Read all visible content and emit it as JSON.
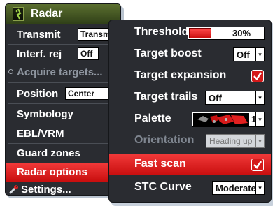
{
  "menu": {
    "title": "Radar",
    "items": [
      {
        "label": "Transmit",
        "value": "Transm"
      },
      {
        "label": "Interf. rej",
        "value": "Off"
      },
      {
        "label": "Acquire targets..."
      },
      {
        "label": "Position",
        "value": "Center"
      },
      {
        "label": "Symbology"
      },
      {
        "label": "EBL/VRM"
      },
      {
        "label": "Guard zones"
      },
      {
        "label": "Radar options"
      },
      {
        "label": "Settings..."
      }
    ]
  },
  "options": {
    "threshold": {
      "label": "Threshold",
      "value": "30%",
      "level": 0.3
    },
    "target_boost": {
      "label": "Target boost",
      "value": "Off"
    },
    "target_expansion": {
      "label": "Target expansion",
      "checked": true
    },
    "target_trails": {
      "label": "Target trails",
      "value": "Off"
    },
    "palette": {
      "label": "Palette",
      "value": "1"
    },
    "orientation": {
      "label": "Orientation",
      "value": "Heading up"
    },
    "fast_scan": {
      "label": "Fast scan",
      "checked": true
    },
    "stc_curve": {
      "label": "STC Curve",
      "value": "Moderate"
    }
  },
  "colors": {
    "accent": "#e01e1e",
    "menu_bg": "#2a2c31",
    "header": "#4a5e24"
  }
}
